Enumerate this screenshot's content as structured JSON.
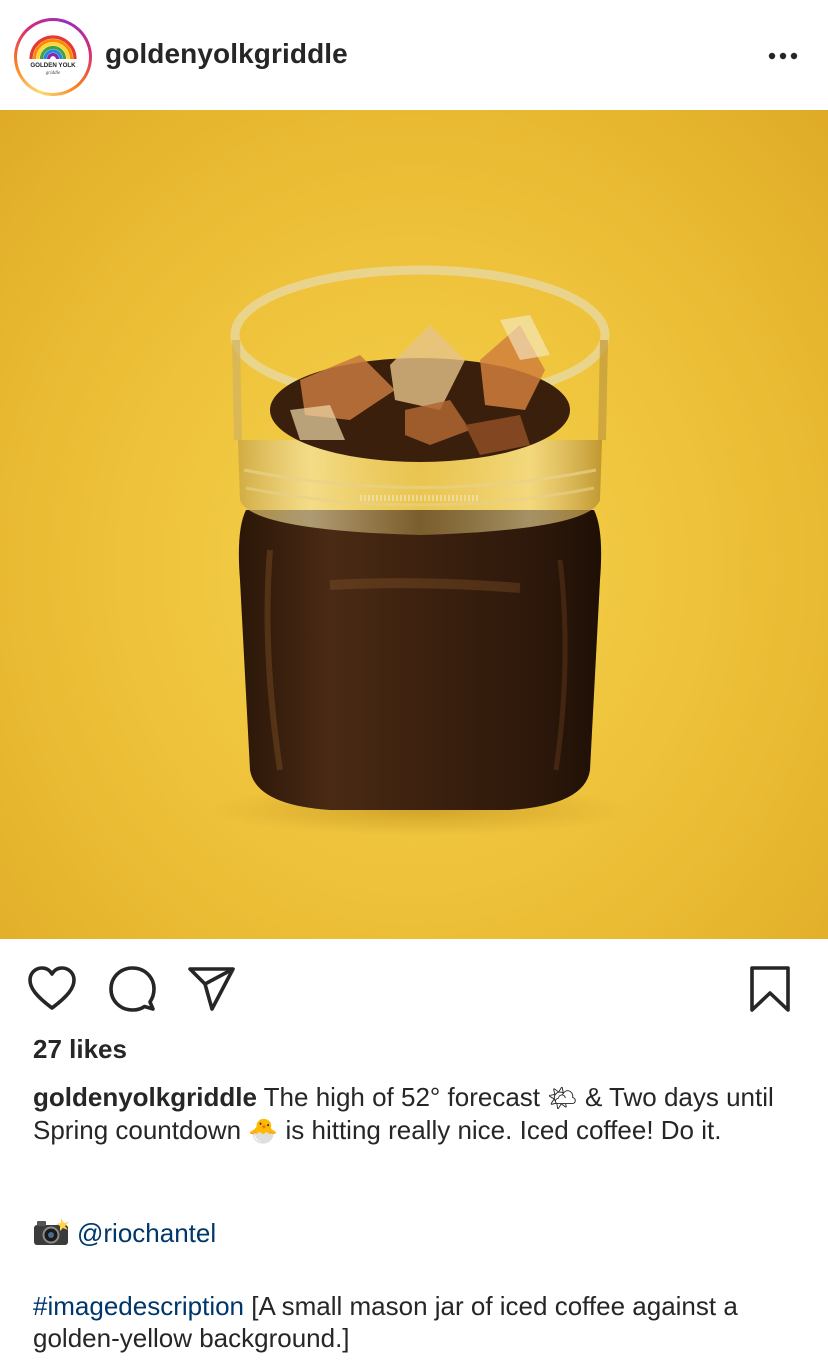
{
  "post": {
    "username": "goldenyolkgriddle",
    "avatar_text_top": "GOLDEN YOLK",
    "avatar_text_bottom": "griddle",
    "more_icon": "ellipsis-icon",
    "photo_alt": "A small mason jar of iced coffee against a golden-yellow background",
    "likes_text": "27 likes"
  },
  "actions": {
    "like_icon": "heart-icon",
    "comment_icon": "comment-icon",
    "share_icon": "paper-plane-icon",
    "save_icon": "bookmark-icon"
  },
  "caption": {
    "username": "goldenyolkgriddle",
    "part1": " The high of 52° forecast ",
    "emoji1": "🌤",
    "part2": " & Two days until Spring countdown ",
    "emoji2": "🐣",
    "part3": " is hitting really nice. Iced coffee! Do it.",
    "camera_icon": "camera-flash-icon",
    "mention": "@riochantel",
    "hashtag": "#imagedescription",
    "description": " [A small mason jar of iced coffee against a golden-yellow background.]"
  },
  "colors": {
    "text": "#262626",
    "link": "#00376b",
    "photo_bg": "#efc43c"
  }
}
